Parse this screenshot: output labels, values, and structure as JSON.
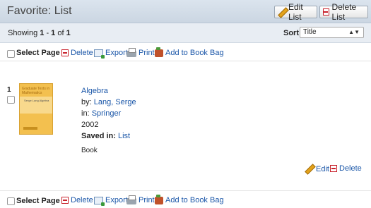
{
  "header": {
    "title": "Favorite: List",
    "edit_list_label": "Edit List",
    "delete_list_label": "Delete List"
  },
  "subbar": {
    "showing_prefix": "Showing ",
    "start": "1",
    "dash": " - ",
    "end": "1",
    "of": " of ",
    "total": "1",
    "sort_label": "Sort",
    "sort_value": "Title"
  },
  "toolbar": {
    "select_page": "Select Page",
    "delete": "Delete",
    "export": "Export",
    "print": "Print",
    "add_to_book_bag": "Add to Book Bag"
  },
  "record": {
    "number": "1",
    "cover_text_top": "Graduate Texts in Mathematics",
    "cover_text_mid": "Serge Lang Algebra",
    "title": "Algebra",
    "by_label": "by: ",
    "author": "Lang, Serge",
    "in_label": "in: ",
    "publisher": "Springer",
    "year": "2002",
    "saved_in_label": "Saved in: ",
    "saved_in_value": "List",
    "format": "Book",
    "edit_label": "Edit",
    "delete_label": "Delete"
  },
  "icons": {
    "edit": "pencil-icon",
    "delete": "minus-box-icon",
    "export": "export-icon",
    "print": "printer-icon",
    "book_bag": "book-bag-icon"
  }
}
